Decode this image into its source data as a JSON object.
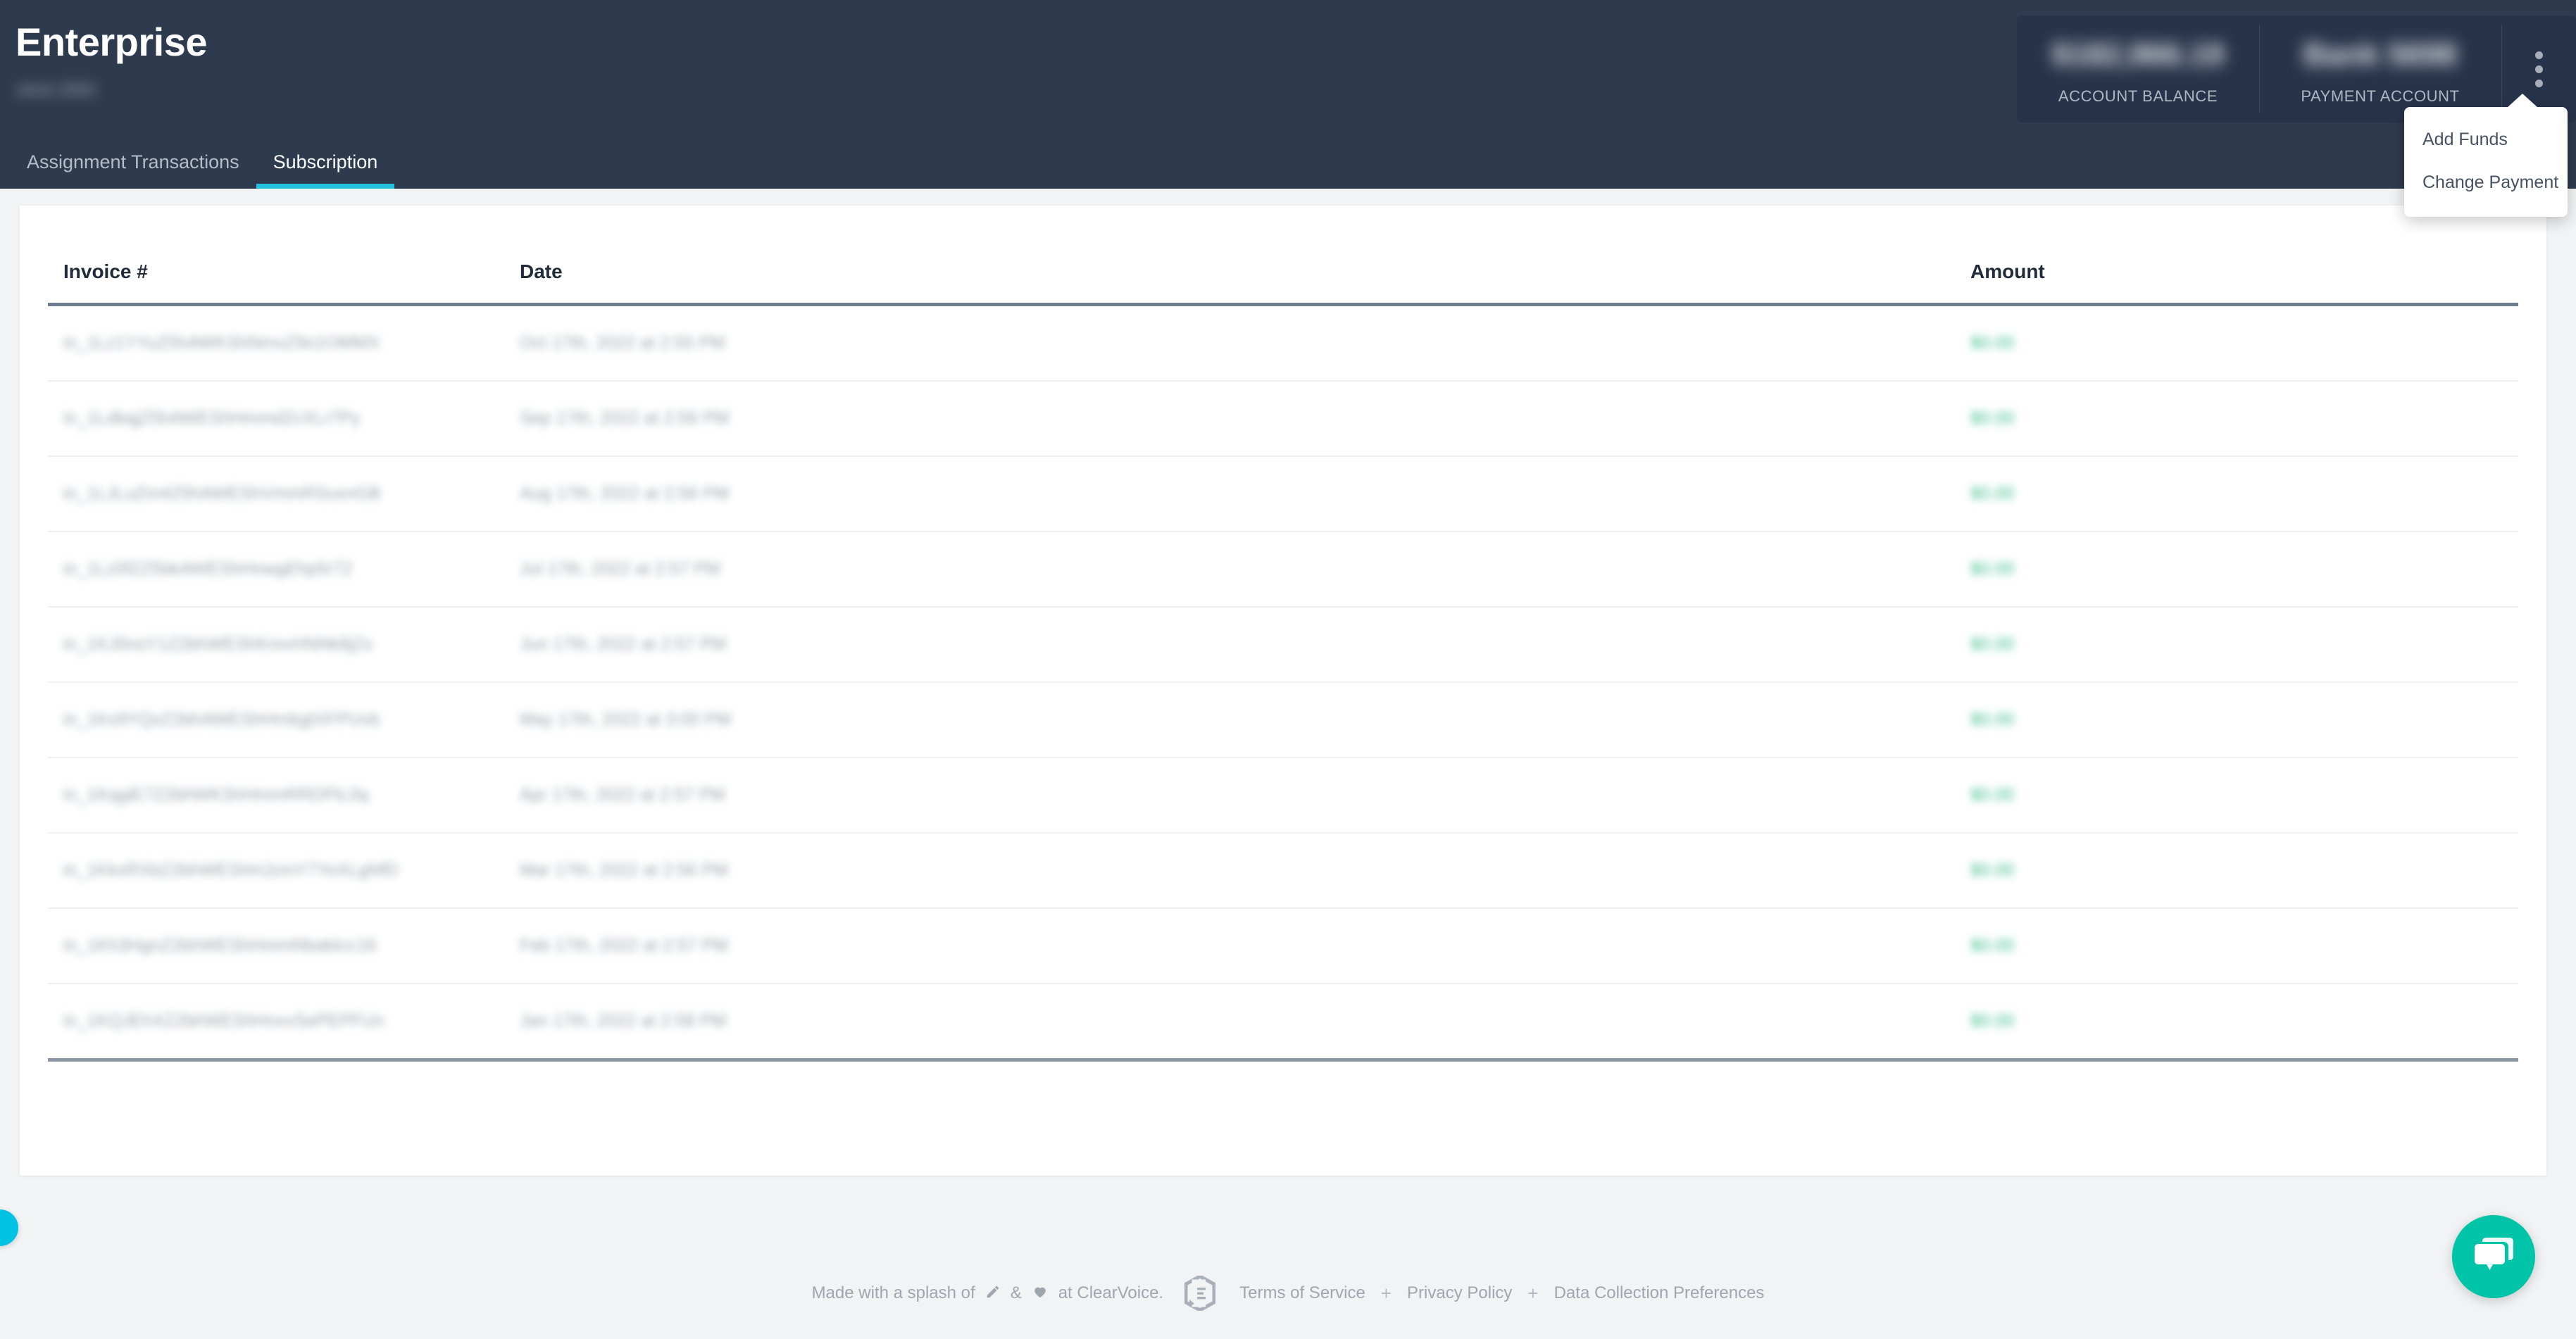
{
  "header": {
    "title": "Enterprise",
    "subtitle_redacted": "since 2020",
    "stats": [
      {
        "label": "ACCOUNT BALANCE",
        "value_redacted": "$182,966.19"
      },
      {
        "label": "PAYMENT ACCOUNT",
        "value_redacted": "Bank 5698"
      }
    ],
    "menu_icon": "kebab-menu-icon",
    "dropdown": {
      "items": [
        {
          "label": "Add Funds"
        },
        {
          "label": "Change Payment"
        }
      ]
    },
    "tabs": [
      {
        "label": "Assignment Transactions",
        "active": false
      },
      {
        "label": "Subscription",
        "active": true
      }
    ]
  },
  "table": {
    "columns": [
      "Invoice #",
      "Date",
      "",
      "Amount"
    ],
    "rows": [
      {
        "invoice_redacted": "in_1Lz1YYuZ5hAWKShNmvZ9o1OMMX",
        "date_redacted": "Oct 17th, 2022 at 2:55 PM",
        "amount_redacted": "$0.00"
      },
      {
        "invoice_redacted": "in_1LdbqjZ5hAWEShHmmdZcXLr7Py",
        "date_redacted": "Sep 17th, 2022 at 2:56 PM",
        "amount_redacted": "$0.00"
      },
      {
        "invoice_redacted": "in_1LJLuZm4Z5hAWEShVmmRSuxnGB",
        "date_redacted": "Aug 17th, 2022 at 2:56 PM",
        "amount_redacted": "$0.00"
      },
      {
        "invoice_redacted": "in_1Lz0fZZ5bkAWEShHnwgEhp5r72",
        "date_redacted": "Jul 17th, 2022 at 2:57 PM",
        "amount_redacted": "$0.00"
      },
      {
        "invoice_redacted": "in_1KJ0nsY1Z2bhWEShKmvHNNk8jZs",
        "date_redacted": "Jun 17th, 2022 at 2:57 PM",
        "amount_redacted": "$0.00"
      },
      {
        "invoice_redacted": "in_1Ks9YQxZ2bhAWEShHmbgtXFPUvb",
        "date_redacted": "May 17th, 2022 at 3:00 PM",
        "amount_redacted": "$0.00"
      },
      {
        "invoice_redacted": "in_1KqgiE7Z2bhWKShHmmRRDPiL0q",
        "date_redacted": "Apr 17th, 2022 at 2:57 PM",
        "amount_redacted": "$0.00"
      },
      {
        "invoice_redacted": "in_1KkxRXbZ2bhWEShHJzmY7YoXLgNfD",
        "date_redacted": "Mar 17th, 2022 at 2:56 PM",
        "amount_redacted": "$0.00"
      },
      {
        "invoice_redacted": "in_1Kh3HgnZ2bhWEShHmmNbabIcc16",
        "date_redacted": "Feb 17th, 2022 at 2:57 PM",
        "amount_redacted": "$0.00"
      },
      {
        "invoice_redacted": "in_1KQJEhXZ2bhWEShHnxvSePEPFUn",
        "date_redacted": "Jan 17th, 2022 at 2:58 PM",
        "amount_redacted": "$0.00"
      }
    ]
  },
  "footer": {
    "made_prefix": "Made with a splash of",
    "pencil_icon": "pencil-icon",
    "ampersand": "&",
    "heart_icon": "heart-icon",
    "made_suffix": "at ClearVoice.",
    "logo": "clearvoice-logo-icon",
    "links": [
      {
        "label": "Terms of Service"
      },
      {
        "label": "Privacy Policy"
      },
      {
        "label": "Data Collection Preferences"
      }
    ],
    "separator": "+"
  },
  "widgets": {
    "chat_icon": "chat-bubble-icon",
    "chat_color": "#00c4a7",
    "edge_tab_color": "#00c3e3"
  },
  "theme": {
    "header_bg": "#2e3b4e",
    "stat_bg": "#27334a",
    "accent": "#22c1dd",
    "page_bg": "#f2f3f4",
    "amount_green": "#3dbd8f"
  }
}
